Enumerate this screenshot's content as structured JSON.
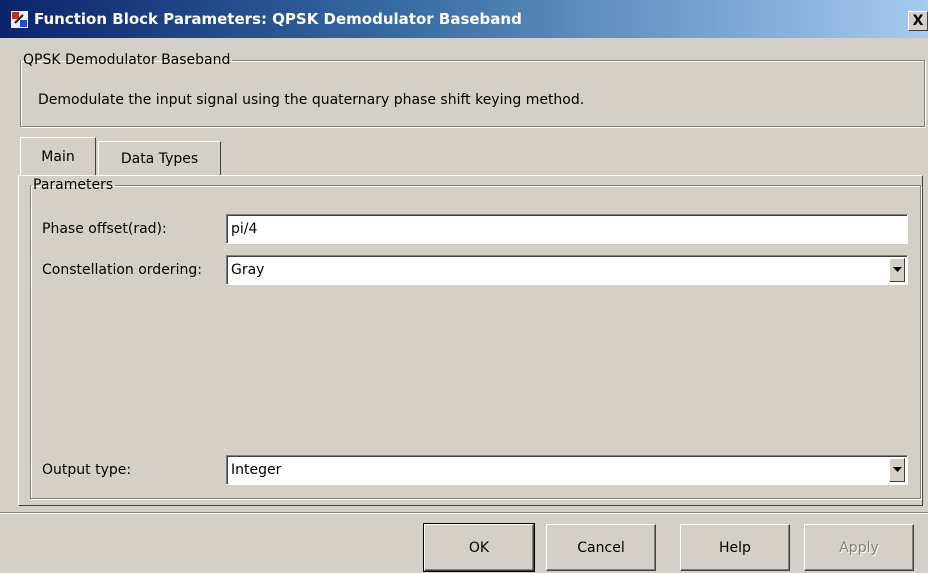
{
  "window": {
    "title": "Function Block Parameters: QPSK Demodulator Baseband",
    "close_label": "X"
  },
  "block_group": {
    "legend": "QPSK Demodulator Baseband",
    "description": "Demodulate the input signal using the quaternary phase shift keying method."
  },
  "tabs": [
    {
      "label": "Main",
      "active": true
    },
    {
      "label": "Data Types",
      "active": false
    }
  ],
  "parameters": {
    "legend": "Parameters",
    "phase_offset": {
      "label": "Phase offset(rad):",
      "value": "pi/4"
    },
    "constellation_ordering": {
      "label": "Constellation ordering:",
      "value": "Gray"
    },
    "output_type": {
      "label": "Output type:",
      "value": "Integer"
    }
  },
  "buttons": {
    "ok": "OK",
    "cancel": "Cancel",
    "help": "Help",
    "apply": "Apply"
  }
}
